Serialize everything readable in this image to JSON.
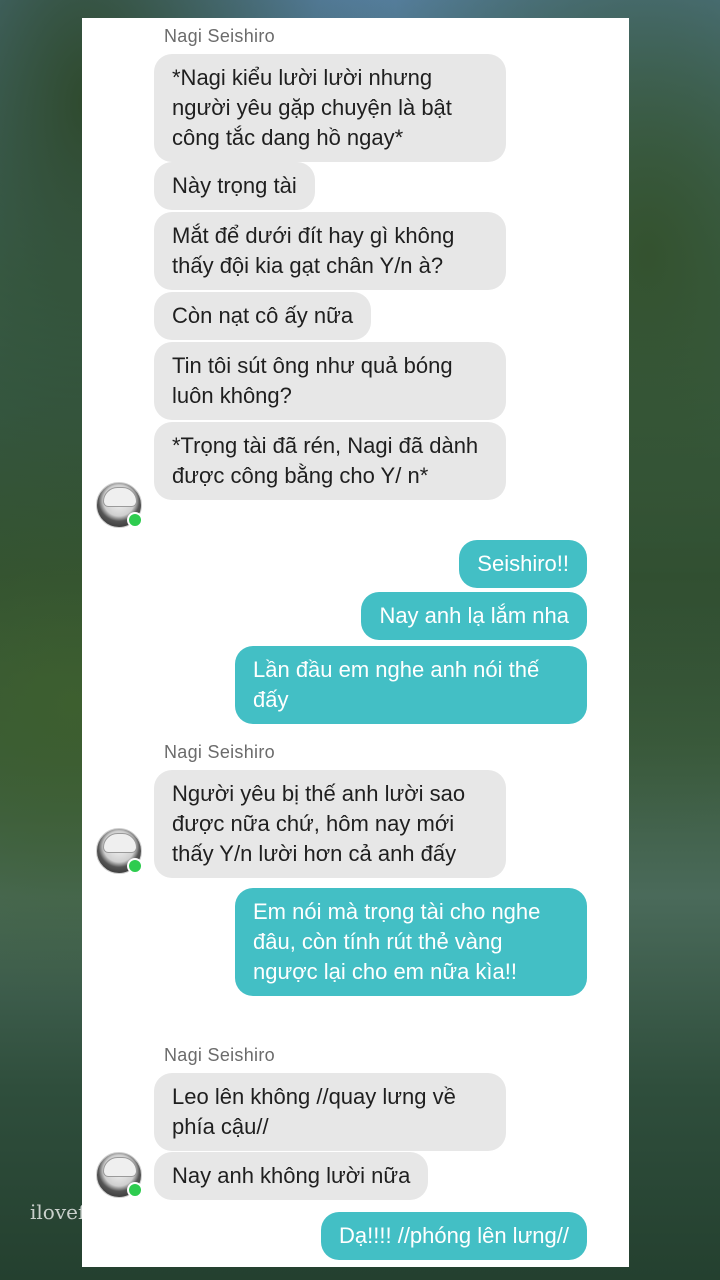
{
  "background": {
    "watermark": "ilovef"
  },
  "contact": {
    "name": "Nagi Seishiro"
  },
  "colors": {
    "incoming_bubble": "#e7e7e7",
    "outgoing_bubble": "#43bfc5",
    "online_dot": "#2ecc4f"
  },
  "groups": [
    {
      "sender": "Nagi Seishiro",
      "messages": [
        "*Nagi kiểu lười lười nhưng người yêu gặp chuyện là bật công tắc dang hồ ngay*",
        "Này trọng tài",
        "Mắt để dưới đít hay gì không thấy đội kia gạt chân Y/n à?",
        "Còn nạt cô ấy nữa",
        "Tin tôi sút ông như quả bóng luôn không?",
        "*Trọng tài đã rén, Nagi đã dành được công bằng cho Y/ n*"
      ]
    },
    {
      "sender": "me",
      "messages": [
        "Seishiro!!",
        "Nay anh lạ lắm nha",
        "Lần đầu em nghe anh nói thế đấy"
      ]
    },
    {
      "sender": "Nagi Seishiro",
      "messages": [
        "Người yêu bị thế anh lười sao được nữa chứ, hôm nay mới thấy Y/n lười hơn cả anh đấy"
      ]
    },
    {
      "sender": "me",
      "messages": [
        "Em nói mà trọng tài cho nghe đâu, còn tính rút thẻ vàng ngược lại cho em nữa kìa!!"
      ]
    },
    {
      "sender": "Nagi Seishiro",
      "messages": [
        "Leo lên không //quay lưng về phía cậu//",
        "Nay anh không lười nữa"
      ]
    },
    {
      "sender": "me",
      "messages": [
        "Dạ!!!! //phóng lên lưng//"
      ]
    }
  ]
}
